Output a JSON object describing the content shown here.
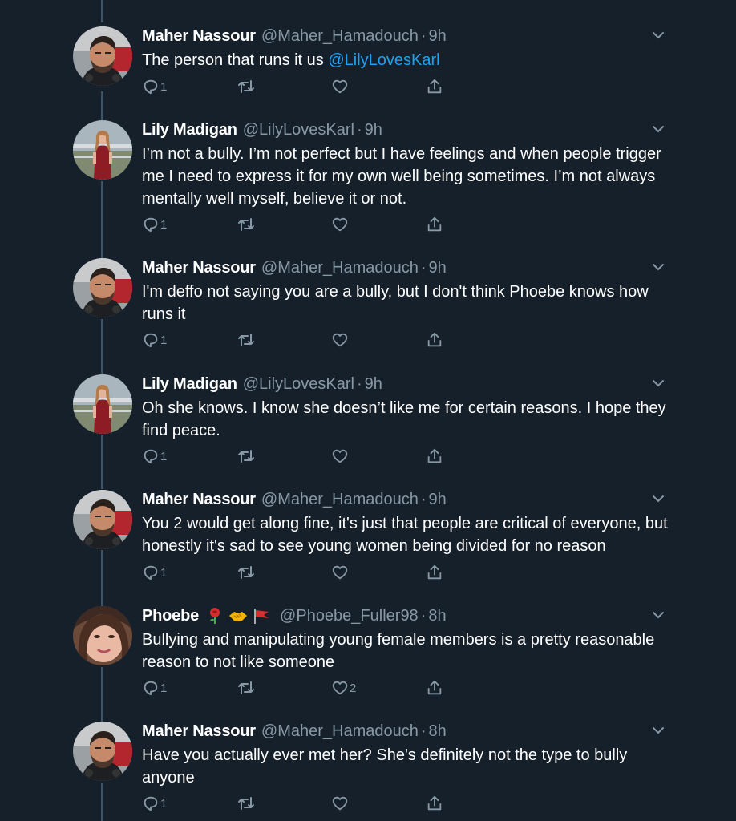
{
  "colors": {
    "background": "#15202b",
    "secondary_text": "#8899a6",
    "link": "#1da1f2",
    "thread_line": "#3d5466"
  },
  "tweets": [
    {
      "name": "Maher Nassour",
      "handle": "@Maher_Hamadouch",
      "time": "9h",
      "text_before_mention": "The person that runs it us ",
      "mention": "@LilyLovesKarl",
      "text": "",
      "reply_count": "1",
      "like_count": ""
    },
    {
      "name": "Lily Madigan",
      "handle": "@LilyLovesKarl",
      "time": "9h",
      "text": "I’m not a bully. I’m not perfect but I have feelings and when people trigger me I need to express it for my own well being sometimes. I’m not always mentally well myself, believe it or not.",
      "reply_count": "1",
      "like_count": ""
    },
    {
      "name": "Maher Nassour",
      "handle": "@Maher_Hamadouch",
      "time": "9h",
      "text": "I'm deffo not saying you are a bully, but I don't think Phoebe knows how runs it",
      "reply_count": "1",
      "like_count": ""
    },
    {
      "name": "Lily Madigan",
      "handle": "@LilyLovesKarl",
      "time": "9h",
      "text": "Oh she knows. I know she doesn’t like me for certain reasons. I hope they find peace.",
      "reply_count": "1",
      "like_count": ""
    },
    {
      "name": "Maher Nassour",
      "handle": "@Maher_Hamadouch",
      "time": "9h",
      "text": "You 2 would get along fine, it's just that people are critical of everyone, but honestly it's sad to see young women being divided for no reason",
      "reply_count": "1",
      "like_count": ""
    },
    {
      "name": "Phoebe",
      "name_emojis": [
        "rose-icon",
        "handshake-icon",
        "red-flag-icon"
      ],
      "handle": "@Phoebe_Fuller98",
      "time": "8h",
      "text": "Bullying and manipulating young female members is a pretty reasonable reason to not like someone",
      "reply_count": "1",
      "like_count": "2"
    },
    {
      "name": "Maher Nassour",
      "handle": "@Maher_Hamadouch",
      "time": "8h",
      "text": "Have you actually ever met her? She's definitely not the type to bully anyone",
      "reply_count": "1",
      "like_count": ""
    }
  ],
  "icons": {
    "reply": "reply-icon",
    "retweet": "retweet-icon",
    "like": "heart-icon",
    "share": "share-icon",
    "more": "chevron-down-icon"
  },
  "separator": "·"
}
